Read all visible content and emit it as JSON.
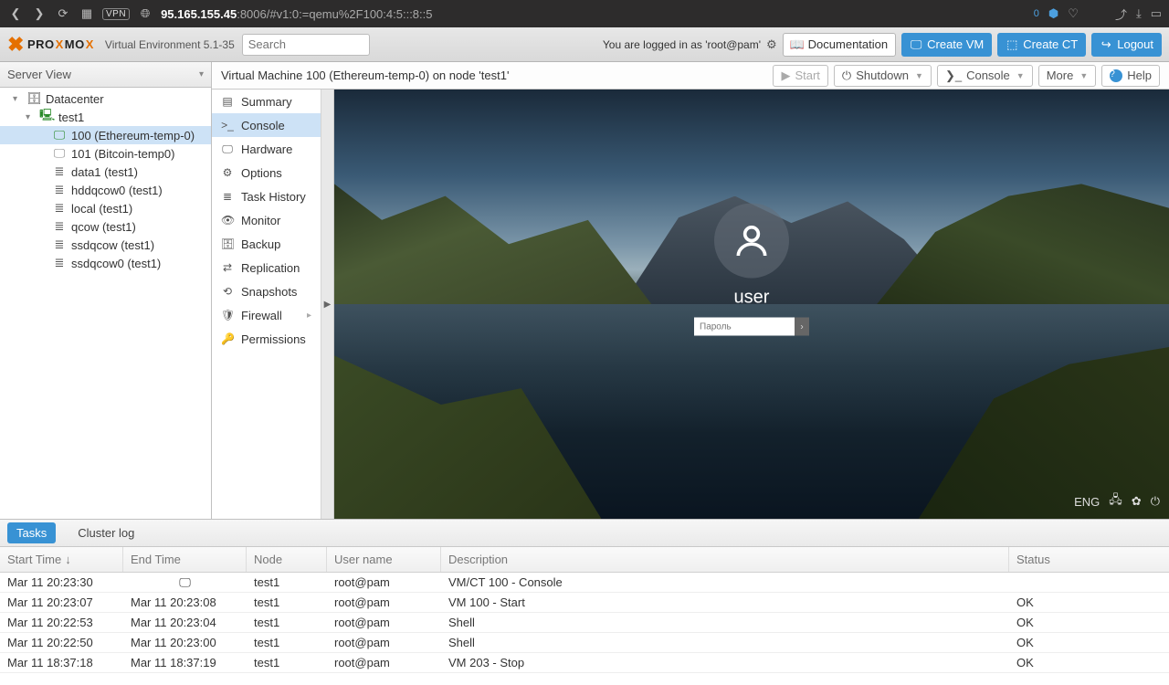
{
  "browser": {
    "vpn": "VPN",
    "url_host": "95.165.155.45",
    "url_rest": ":8006/#v1:0:=qemu%2F100:4:5:::8::5",
    "badge_zero": "0"
  },
  "header": {
    "brand_p1": "PRO",
    "brand_x": "X",
    "brand_p2": "MO",
    "brand_x2": "X",
    "subtitle": "Virtual Environment 5.1-35",
    "search_placeholder": "Search",
    "logged_in": "You are logged in as 'root@pam'",
    "doc": "Documentation",
    "create_vm": "Create VM",
    "create_ct": "Create CT",
    "logout": "Logout"
  },
  "tree": {
    "view_label": "Server View",
    "datacenter": "Datacenter",
    "node": "test1",
    "vm100": "100 (Ethereum-temp-0)",
    "vm101": "101 (Bitcoin-temp0)",
    "storages": [
      "data1 (test1)",
      "hddqcow0 (test1)",
      "local (test1)",
      "qcow (test1)",
      "ssdqcow (test1)",
      "ssdqcow0 (test1)"
    ]
  },
  "toolbar": {
    "crumb": "Virtual Machine 100 (Ethereum-temp-0) on node 'test1'",
    "start": "Start",
    "shutdown": "Shutdown",
    "console": "Console",
    "more": "More",
    "help": "Help"
  },
  "submenu": {
    "items": [
      "Summary",
      "Console",
      "Hardware",
      "Options",
      "Task History",
      "Monitor",
      "Backup",
      "Replication",
      "Snapshots",
      "Firewall",
      "Permissions"
    ],
    "icons": [
      "▤",
      ">_",
      "🖵",
      "⚙",
      "≣",
      "👁",
      "🗄",
      "⇄",
      "⟲",
      "🛡",
      "🔑"
    ]
  },
  "vm_login": {
    "user": "user",
    "pw_placeholder": "Пароль",
    "lang": "ENG"
  },
  "tasks": {
    "tab_tasks": "Tasks",
    "tab_cluster": "Cluster log",
    "cols": {
      "start": "Start Time",
      "end": "End Time",
      "node": "Node",
      "user": "User name",
      "desc": "Description",
      "status": "Status"
    },
    "rows": [
      {
        "start": "Mar 11 20:23:30",
        "end": "",
        "node": "test1",
        "user": "root@pam",
        "desc": "VM/CT 100 - Console",
        "status": "",
        "running": true
      },
      {
        "start": "Mar 11 20:23:07",
        "end": "Mar 11 20:23:08",
        "node": "test1",
        "user": "root@pam",
        "desc": "VM 100 - Start",
        "status": "OK"
      },
      {
        "start": "Mar 11 20:22:53",
        "end": "Mar 11 20:23:04",
        "node": "test1",
        "user": "root@pam",
        "desc": "Shell",
        "status": "OK"
      },
      {
        "start": "Mar 11 20:22:50",
        "end": "Mar 11 20:23:00",
        "node": "test1",
        "user": "root@pam",
        "desc": "Shell",
        "status": "OK"
      },
      {
        "start": "Mar 11 18:37:18",
        "end": "Mar 11 18:37:19",
        "node": "test1",
        "user": "root@pam",
        "desc": "VM 203 - Stop",
        "status": "OK"
      }
    ]
  }
}
